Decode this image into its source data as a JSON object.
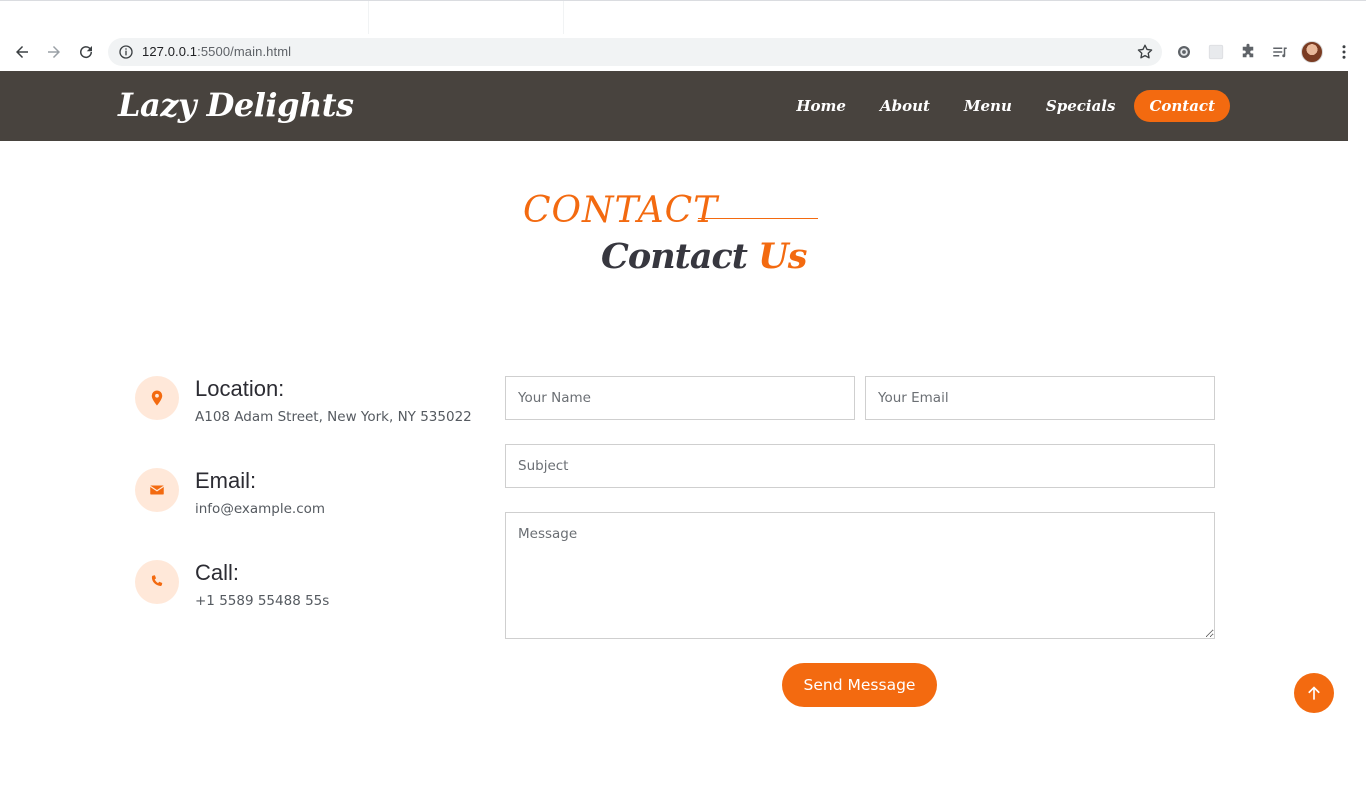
{
  "browser": {
    "url_host": "127.0.0.1",
    "url_rest": ":5500/main.html"
  },
  "site": {
    "logo": "Lazy Delights",
    "nav": [
      "Home",
      "About",
      "Menu",
      "Specials",
      "Contact"
    ],
    "active_nav": "Contact"
  },
  "section": {
    "title": "CONTACT",
    "subtitle_main": "Contact",
    "subtitle_accent": "Us"
  },
  "info": [
    {
      "title": "Location:",
      "text": "A108 Adam Street, New York, NY 535022",
      "icon": "map-pin-icon"
    },
    {
      "title": "Email:",
      "text": "info@example.com",
      "icon": "envelope-icon"
    },
    {
      "title": "Call:",
      "text": "+1 5589 55488 55s",
      "icon": "phone-icon"
    }
  ],
  "form": {
    "name_placeholder": "Your Name",
    "email_placeholder": "Your Email",
    "subject_placeholder": "Subject",
    "message_placeholder": "Message",
    "submit_label": "Send Message"
  },
  "colors": {
    "accent": "#f36a10",
    "header_bg": "#48433e",
    "icon_bg": "#ffe8d9",
    "text_dark": "#37373f"
  }
}
